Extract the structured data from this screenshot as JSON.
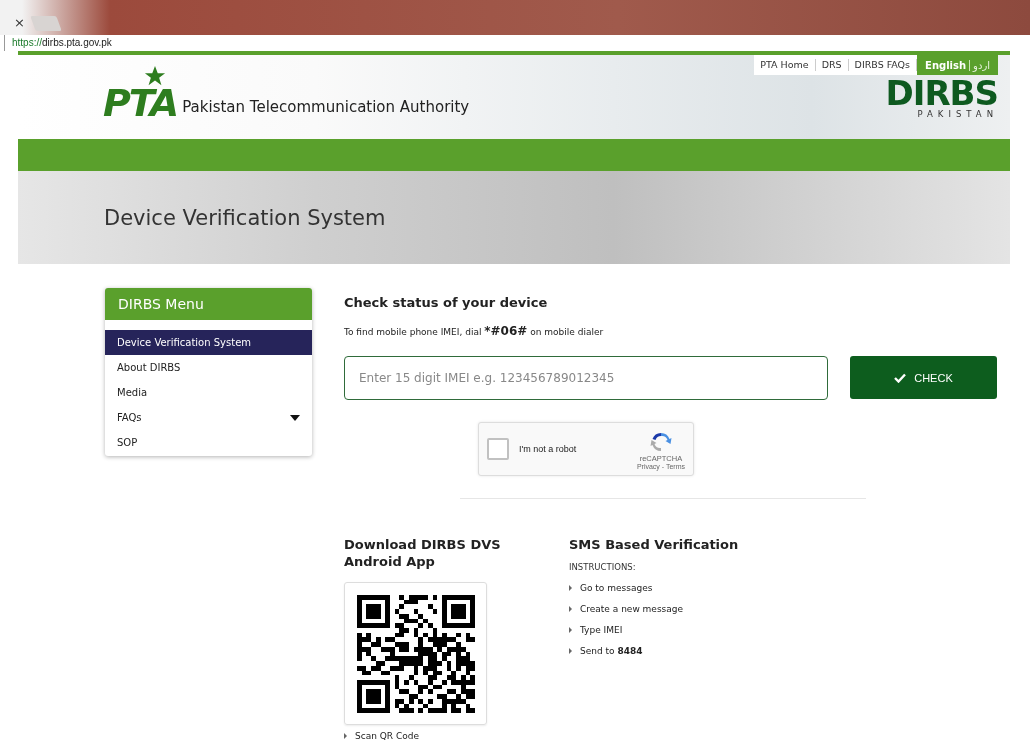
{
  "browser": {
    "tab_close": "×",
    "url_scheme": "https://",
    "url_rest": "dirbs.pta.gov.pk"
  },
  "header": {
    "logo_mark": "PTA",
    "logo_text": "Pakistan Telecommunication Authority",
    "top_links": [
      {
        "label": "PTA Home",
        "selected": false
      },
      {
        "label": "DRS",
        "selected": false
      },
      {
        "label": "DIRBS FAQs",
        "selected": false
      }
    ],
    "languages": [
      {
        "label": "English",
        "selected": true
      },
      {
        "label": "اردو",
        "selected": false
      }
    ],
    "dirbs_logo": "DIRBS",
    "dirbs_sub": "PAKISTAN"
  },
  "banner": {
    "title": "Device Verification System"
  },
  "sidebar": {
    "title": "DIRBS Menu",
    "items": [
      {
        "label": "Device Verification System",
        "selected": true,
        "expandable": false
      },
      {
        "label": "About DIRBS",
        "selected": false,
        "expandable": false
      },
      {
        "label": "Media",
        "selected": false,
        "expandable": false
      },
      {
        "label": "FAQs",
        "selected": false,
        "expandable": true
      },
      {
        "label": "SOP",
        "selected": false,
        "expandable": false
      }
    ]
  },
  "check": {
    "heading": "Check status of your device",
    "hint": "To find mobile phone IMEI, dial ***#06#** on mobile dialer",
    "placeholder": "Enter 15 digit IMEI e.g. 123456789012345",
    "button": "CHECK"
  },
  "captcha": {
    "label": "I'm not a robot",
    "checked": false,
    "brand": "reCAPTCHA",
    "links": "Privacy - Terms"
  },
  "app": {
    "heading": "Download DIRBS DVS Android App",
    "caption": "Scan QR Code"
  },
  "sms": {
    "heading": "SMS Based Verification",
    "subheading": "INSTRUCTIONS:",
    "steps": [
      "Go to messages",
      "Create a new message",
      "Type IMEI",
      "Send to **8484**"
    ]
  }
}
